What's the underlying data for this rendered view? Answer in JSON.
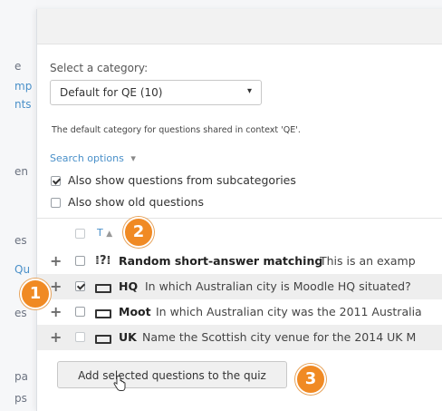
{
  "background": {
    "fragments": [
      {
        "text": "e",
        "link": false
      },
      {
        "text": "mp",
        "link": true
      },
      {
        "text": "nts",
        "link": true
      },
      {
        "text": "en",
        "link": false
      },
      {
        "text": "es",
        "link": false
      },
      {
        "text": "Qu",
        "link": true
      },
      {
        "text": "es",
        "link": false
      },
      {
        "text": "pa",
        "link": false
      },
      {
        "text": "ps",
        "link": false
      }
    ]
  },
  "dialog": {
    "select_category_label": "Select a category:",
    "category_value": "Default for QE (10)",
    "category_caret": "▾",
    "category_description": "The default category for questions shared in context 'QE'.",
    "search_options_label": "Search options",
    "search_options_caret": "▾",
    "option_subcategories": {
      "label": "Also show questions from subcategories",
      "checked": true
    },
    "option_old_questions": {
      "label": "Also show old questions",
      "checked": false
    },
    "table_header": {
      "sort_label": "T",
      "sort_arrow": "▲"
    },
    "rows": [
      {
        "name": "Random short-answer matching",
        "text": "This is an examp",
        "checked": false,
        "icon": "random-question-icon",
        "icon_glyph": "⁞?⁞"
      },
      {
        "name": "HQ",
        "text": "In which Australian city is Moodle HQ situated?",
        "checked": true,
        "icon": "short-answer-icon"
      },
      {
        "name": "Moot",
        "text": "In which Australian city was the 2011 Australia",
        "checked": false,
        "icon": "short-answer-icon"
      },
      {
        "name": "UK",
        "text": "Name  the Scottish city venue for the 2014 UK M",
        "checked": false,
        "icon": "short-answer-icon"
      }
    ],
    "add_button_label": "Add selected questions to the quiz"
  },
  "callouts": [
    "1",
    "2",
    "3"
  ],
  "colors": {
    "callout": "#f08a24",
    "link": "#4a90c9",
    "row_shade": "#eeeeee"
  }
}
